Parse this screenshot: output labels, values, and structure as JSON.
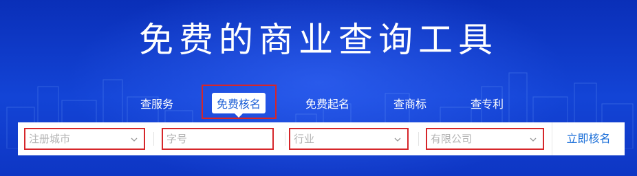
{
  "banner": {
    "title": "免费的商业查询工具"
  },
  "tabs": [
    {
      "label": "查服务"
    },
    {
      "label": "免费核名"
    },
    {
      "label": "免费起名"
    },
    {
      "label": "查商标"
    },
    {
      "label": "查专利"
    }
  ],
  "active_tab": "免费核名",
  "search": {
    "city_placeholder": "注册城市",
    "name_placeholder": "字号",
    "industry_placeholder": "行业",
    "company_type_placeholder": "有限公司",
    "submit_label": "立即核名"
  },
  "colors": {
    "background": "#0d39c6",
    "highlight_border": "#d6262a",
    "accent": "#1a6ed8"
  },
  "icons": [
    "chevron-down-icon"
  ]
}
